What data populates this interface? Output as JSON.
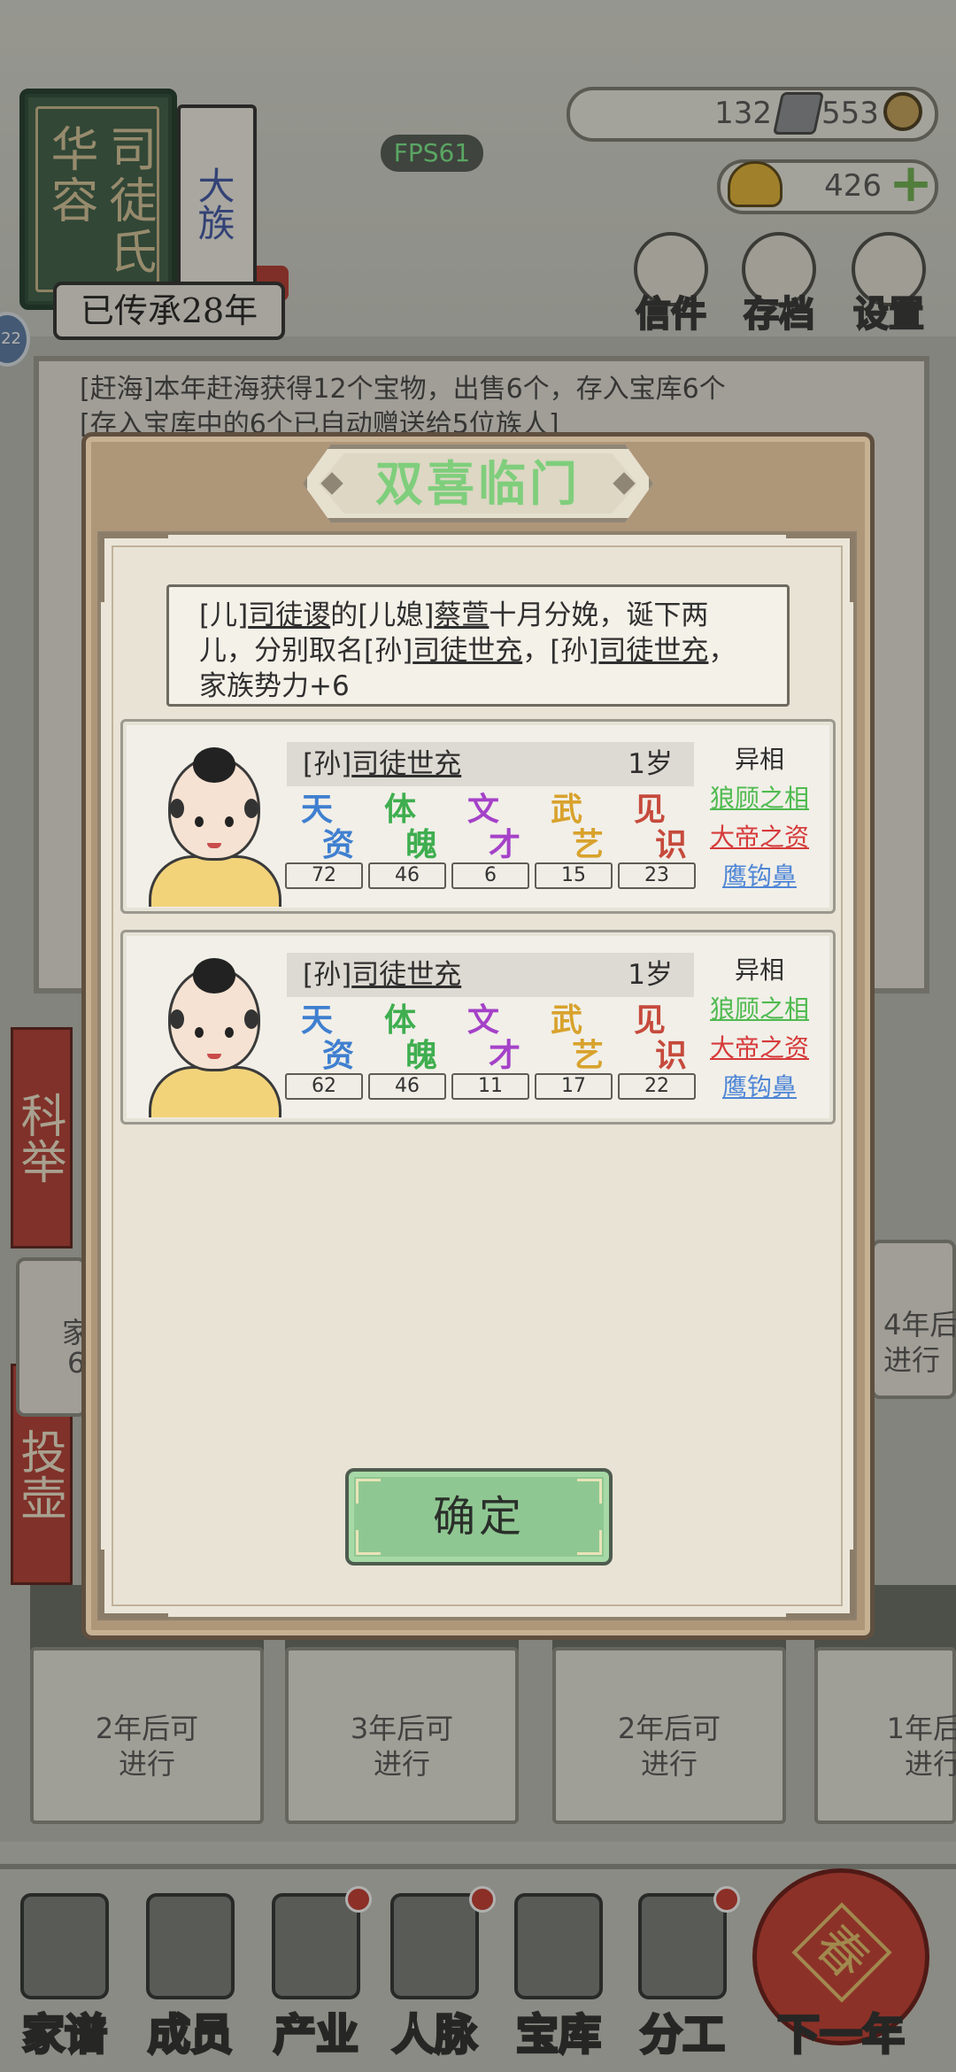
{
  "clan": {
    "region": "华容",
    "surname": "司徒氏",
    "tier": "大族",
    "heritage": "已传承28年"
  },
  "fps": "FPS61",
  "resources": {
    "silver": "132",
    "copper": "553",
    "gold": "426"
  },
  "top_buttons": [
    "信件",
    "存档",
    "设置"
  ],
  "level_badge": "22",
  "log_lines": [
    "[赶海]本年赶海获得12个宝物，出售6个，存入宝库6个",
    "[存入宝库中的6个已自动赠送给5位族人]"
  ],
  "side_tags": [
    "科举",
    "投壶"
  ],
  "side_card_texts": [
    "家",
    "6"
  ],
  "right_card_text": "4年后可进行",
  "bottom_cards": [
    {
      "line1": "2年后可",
      "line2": "进行"
    },
    {
      "line1": "3年后可",
      "line2": "进行"
    },
    {
      "line1": "2年后可",
      "line2": "进行"
    },
    {
      "line1": "1年后",
      "line2": "进行"
    }
  ],
  "bottom_nav": [
    "家谱",
    "成员",
    "产业",
    "人脉",
    "宝库",
    "分工",
    "下一年"
  ],
  "lantern_char": "春",
  "modal": {
    "title": "双喜临门",
    "message": {
      "p1": "[儿]",
      "n1": "司徒谡",
      "p2": "的[儿媳]",
      "n2": "蔡萱",
      "p3": "十月分娩，诞下两儿，分别取名[孙]",
      "n3": "司徒世充",
      "p4": "，[孙]",
      "n4": "司徒世充",
      "p5": "，家族势力+6"
    },
    "stat_labels": [
      {
        "c1": "天",
        "c2": "资",
        "color": "#3f7fd0"
      },
      {
        "c1": "体",
        "c2": "魄",
        "color": "#3fae4f"
      },
      {
        "c1": "文",
        "c2": "才",
        "color": "#a542c8"
      },
      {
        "c1": "武",
        "c2": "艺",
        "color": "#d8a22c"
      },
      {
        "c1": "见",
        "c2": "识",
        "color": "#c64a3c"
      }
    ],
    "trait_header": "异相",
    "children": [
      {
        "prefix": "[孙]",
        "name": "司徒世充",
        "age": "1岁",
        "stats": [
          "72",
          "46",
          "6",
          "15",
          "23"
        ],
        "traits": [
          {
            "text": "狼顾之相",
            "color": "#4fba4f"
          },
          {
            "text": "大帝之资",
            "color": "#d63a3a"
          },
          {
            "text": "鹰钩鼻",
            "color": "#4f86d6"
          }
        ]
      },
      {
        "prefix": "[孙]",
        "name": "司徒世充",
        "age": "1岁",
        "stats": [
          "62",
          "46",
          "11",
          "17",
          "22"
        ],
        "traits": [
          {
            "text": "狼顾之相",
            "color": "#4fba4f"
          },
          {
            "text": "大帝之资",
            "color": "#d63a3a"
          },
          {
            "text": "鹰钩鼻",
            "color": "#4f86d6"
          }
        ]
      }
    ],
    "confirm_label": "确定"
  }
}
